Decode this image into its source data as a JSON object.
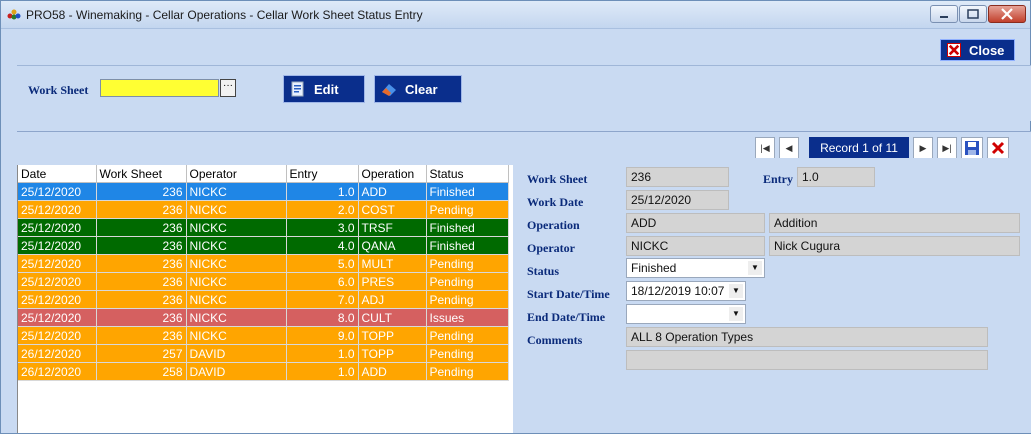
{
  "window": {
    "title": "PRO58 - Winemaking - Cellar Operations - Cellar Work Sheet Status Entry"
  },
  "toolbar": {
    "close_label": "Close"
  },
  "filter": {
    "worksheet_label": "Work Sheet",
    "worksheet_value": "",
    "edit_label": "Edit",
    "clear_label": "Clear"
  },
  "nav": {
    "record_text": "Record 1 of 11"
  },
  "grid": {
    "columns": [
      "Date",
      "Work Sheet",
      "Operator",
      "Entry",
      "Operation",
      "Status"
    ],
    "rows": [
      {
        "date": "25/12/2020",
        "worksheet": "236",
        "operator": "NICKC",
        "entry": "1.0",
        "operation": "ADD",
        "status": "Finished",
        "color": "blue"
      },
      {
        "date": "25/12/2020",
        "worksheet": "236",
        "operator": "NICKC",
        "entry": "2.0",
        "operation": "COST",
        "status": "Pending",
        "color": "orange"
      },
      {
        "date": "25/12/2020",
        "worksheet": "236",
        "operator": "NICKC",
        "entry": "3.0",
        "operation": "TRSF",
        "status": "Finished",
        "color": "green"
      },
      {
        "date": "25/12/2020",
        "worksheet": "236",
        "operator": "NICKC",
        "entry": "4.0",
        "operation": "QANA",
        "status": "Finished",
        "color": "green"
      },
      {
        "date": "25/12/2020",
        "worksheet": "236",
        "operator": "NICKC",
        "entry": "5.0",
        "operation": "MULT",
        "status": "Pending",
        "color": "orange"
      },
      {
        "date": "25/12/2020",
        "worksheet": "236",
        "operator": "NICKC",
        "entry": "6.0",
        "operation": "PRES",
        "status": "Pending",
        "color": "orange"
      },
      {
        "date": "25/12/2020",
        "worksheet": "236",
        "operator": "NICKC",
        "entry": "7.0",
        "operation": "ADJ",
        "status": "Pending",
        "color": "orange"
      },
      {
        "date": "25/12/2020",
        "worksheet": "236",
        "operator": "NICKC",
        "entry": "8.0",
        "operation": "CULT",
        "status": "Issues",
        "color": "red"
      },
      {
        "date": "25/12/2020",
        "worksheet": "236",
        "operator": "NICKC",
        "entry": "9.0",
        "operation": "TOPP",
        "status": "Pending",
        "color": "orange"
      },
      {
        "date": "26/12/2020",
        "worksheet": "257",
        "operator": "DAVID",
        "entry": "1.0",
        "operation": "TOPP",
        "status": "Pending",
        "color": "orange"
      },
      {
        "date": "26/12/2020",
        "worksheet": "258",
        "operator": "DAVID",
        "entry": "1.0",
        "operation": "ADD",
        "status": "Pending",
        "color": "orange"
      }
    ]
  },
  "detail": {
    "worksheet_label": "Work Sheet",
    "worksheet_value": "236",
    "entry_label": "Entry",
    "entry_value": "1.0",
    "workdate_label": "Work Date",
    "workdate_value": "25/12/2020",
    "operation_label": "Operation",
    "operation_value": "ADD",
    "operation_desc": "Addition",
    "operator_label": "Operator",
    "operator_value": "NICKC",
    "operator_name": "Nick Cugura",
    "status_label": "Status",
    "status_value": "Finished",
    "start_label": "Start Date/Time",
    "start_value": "18/12/2019 10:07",
    "end_label": "End Date/Time",
    "end_value": "",
    "comments_label": "Comments",
    "comments_value": "ALL 8 Operation Types",
    "comments_value2": ""
  },
  "colors": {
    "accent": "#0a2e8c",
    "panel": "#c9daf2",
    "finished_selected": "#1f86e6",
    "pending": "#ffa500",
    "finished": "#006a00",
    "issues": "#d56060",
    "input_highlight": "#ffff33"
  }
}
